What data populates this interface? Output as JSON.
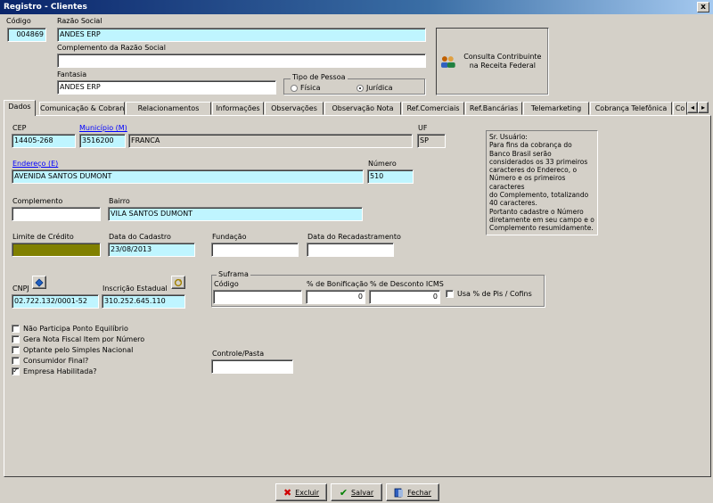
{
  "window": {
    "title": "Registro - Clientes",
    "close_glyph": "x"
  },
  "header": {
    "codigo_label": "Código",
    "codigo_value": "004869",
    "razao_label": "Razão Social",
    "razao_value": "ANDES ERP",
    "complemento_razao_label": "Complemento da Razão Social",
    "complemento_razao_value": "",
    "fantasia_label": "Fantasia",
    "fantasia_value": "ANDES ERP",
    "tipo_pessoa_label": "Tipo de Pessoa",
    "fisica_label": "Física",
    "juridica_label": "Jurídica",
    "tipo_pessoa_selected": "Jurídica",
    "consulta_label": "Consulta Contribuinte na Receita Federal"
  },
  "tabs": [
    {
      "label": "Dados",
      "active": true
    },
    {
      "label": "Comunicação & Cobrança"
    },
    {
      "label": "Relacionamentos"
    },
    {
      "label": "Informações"
    },
    {
      "label": "Observações"
    },
    {
      "label": "Observação Nota"
    },
    {
      "label": "Ref.Comerciais"
    },
    {
      "label": "Ref.Bancárias"
    },
    {
      "label": "Telemarketing"
    },
    {
      "label": "Cobrança Telefônica"
    },
    {
      "label": "Co"
    }
  ],
  "dados": {
    "cep_label": "CEP",
    "cep_value": "14405-268",
    "municipio_label": "Município (M)",
    "municipio_code": "3516200",
    "municipio_name": "FRANCA",
    "uf_label": "UF",
    "uf_value": "SP",
    "endereco_label": "Endereço (E)",
    "endereco_value": "AVENIDA SANTOS DUMONT",
    "numero_label": "Número",
    "numero_value": "510",
    "complemento_label": "Complemento",
    "complemento_value": "",
    "bairro_label": "Bairro",
    "bairro_value": "VILA SANTOS DUMONT",
    "limite_label": "Limite de Crédito",
    "limite_value": "",
    "data_cadastro_label": "Data do Cadastro",
    "data_cadastro_value": "23/08/2013",
    "fundacao_label": "Fundação",
    "fundacao_value": "",
    "data_recad_label": "Data do Recadastramento",
    "data_recad_value": "",
    "cnpj_label": "CNPJ",
    "cnpj_value": "02.722.132/0001-52",
    "ie_label": "Inscrição Estadual",
    "ie_value": "310.252.645.110",
    "suframa_label": "Suframa",
    "suframa_codigo_label": "Código",
    "suframa_codigo_value": "",
    "bonificacao_label": "% de Bonificação",
    "bonificacao_value": "0",
    "desconto_icms_label": "% de Desconto ICMS",
    "desconto_icms_value": "0",
    "usa_pis_label": "Usa % de Pis / Cofins",
    "controle_pasta_label": "Controle/Pasta",
    "controle_pasta_value": "",
    "info_text": "Sr. Usuário:\nPara fins da cobrança do Banco Brasil serão considerados os 33 primeiros caracteres do Endereco, o Número e os primeiros caracteres\ndo Complemento, totalizando 40 caracteres.\nPortanto cadastre o Número diretamente em seu campo e o Complemento resumidamente.",
    "checkboxes": [
      {
        "label": "Não Participa Ponto Equilíbrio",
        "checked": false
      },
      {
        "label": "Gera Nota Fiscal Item por Número",
        "checked": false
      },
      {
        "label": "Optante pelo Simples Nacional",
        "checked": false
      },
      {
        "label": "Consumidor Final?",
        "checked": false
      },
      {
        "label": "Empresa Habilitada?",
        "checked": true
      }
    ]
  },
  "footer": {
    "excluir_label": "Excluir",
    "salvar_label": "Salvar",
    "fechar_label": "Fechar"
  },
  "colors": {
    "titlebar": "#0a246a",
    "cyan_field": "#bff5ff",
    "olive_field": "#808000",
    "link": "#0000ff"
  }
}
